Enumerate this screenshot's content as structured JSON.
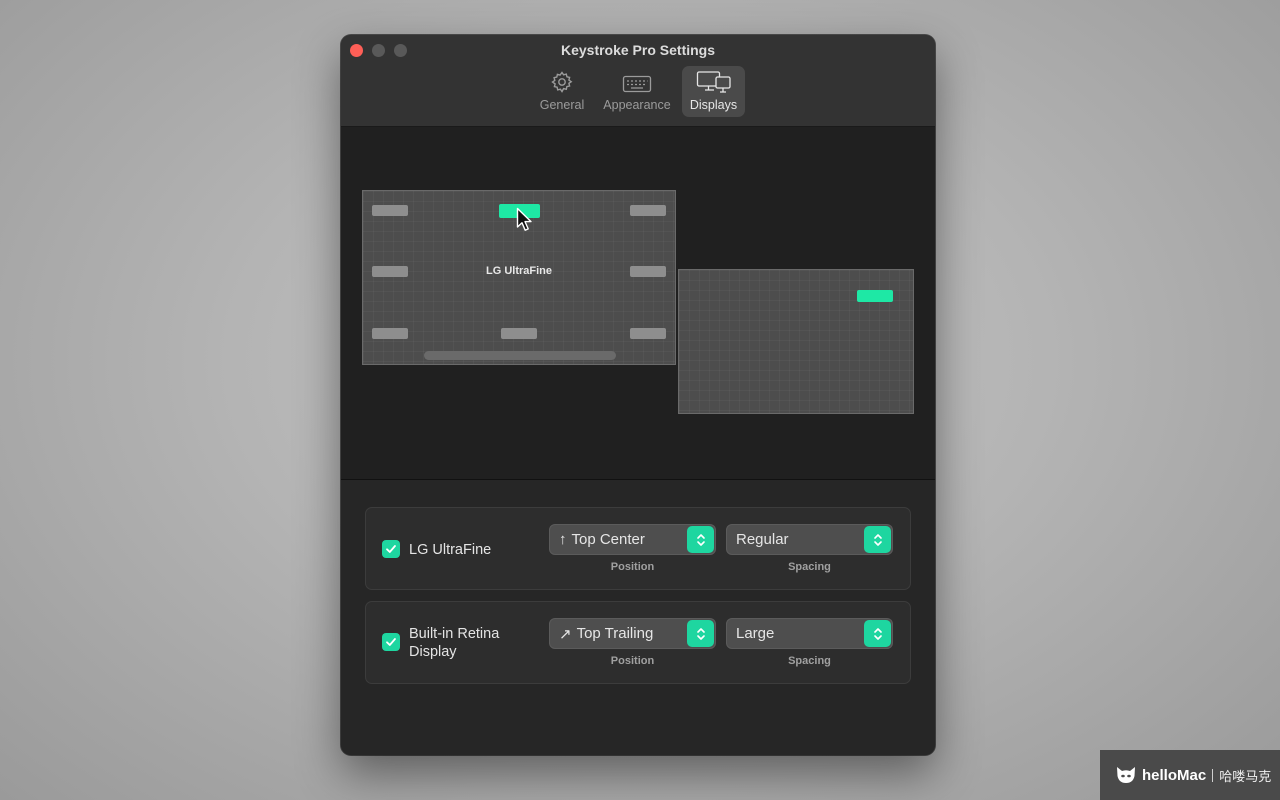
{
  "window": {
    "title": "Keystroke Pro Settings"
  },
  "tabs": [
    {
      "label": "General",
      "icon": "gear-icon"
    },
    {
      "label": "Appearance",
      "icon": "keyboard-icon"
    },
    {
      "label": "Displays",
      "icon": "displays-icon",
      "selected": true
    }
  ],
  "arrangement": {
    "primary_display": {
      "name": "LG UltraFine",
      "active_slot": "top-center"
    },
    "secondary_display": {
      "active_slot": "top-right"
    }
  },
  "displays": [
    {
      "name": "LG UltraFine",
      "enabled": true,
      "position": "Top Center",
      "position_arrow": "↑",
      "position_caption": "Position",
      "spacing": "Regular",
      "spacing_caption": "Spacing"
    },
    {
      "name": "Built-in Retina Display",
      "enabled": true,
      "position": "Top Trailing",
      "position_arrow": "↗",
      "position_caption": "Position",
      "spacing": "Large",
      "spacing_caption": "Spacing"
    }
  ],
  "watermark": {
    "brand": "helloMac",
    "cn": "哈喽马克"
  },
  "colors": {
    "accent": "#1ed6a0",
    "close": "#fe5f57",
    "slot": "#8e8e8e"
  }
}
